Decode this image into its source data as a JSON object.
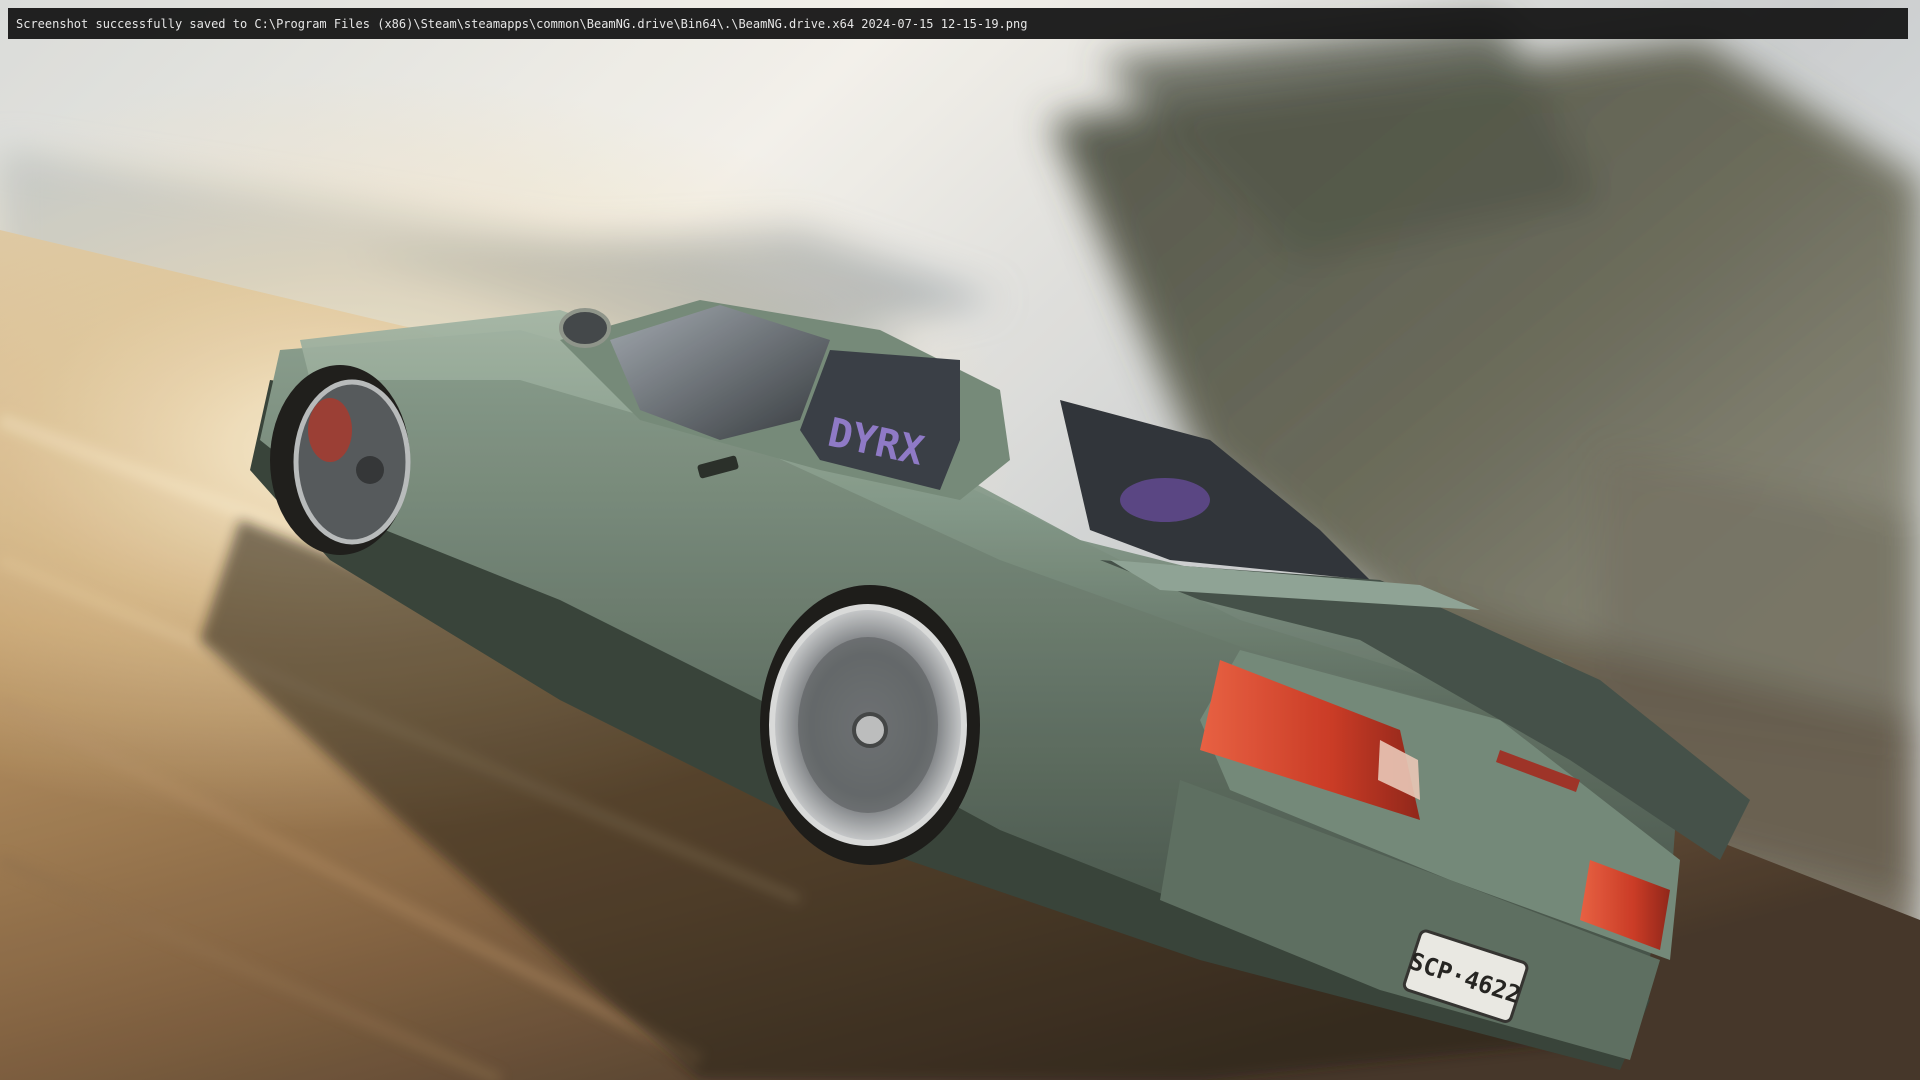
{
  "console": {
    "message": "Screenshot successfully saved to C:\\Program Files (x86)\\Steam\\steamapps\\common\\BeamNG.drive\\Bin64\\.\\BeamNG.drive.x64 2024-07-15 12-15-19.png"
  },
  "scene": {
    "subject": "green-coupe-car-drifting",
    "car_color": "#7d9486",
    "license_plate": "SCP·4622",
    "window_sticker": "DYRX"
  }
}
